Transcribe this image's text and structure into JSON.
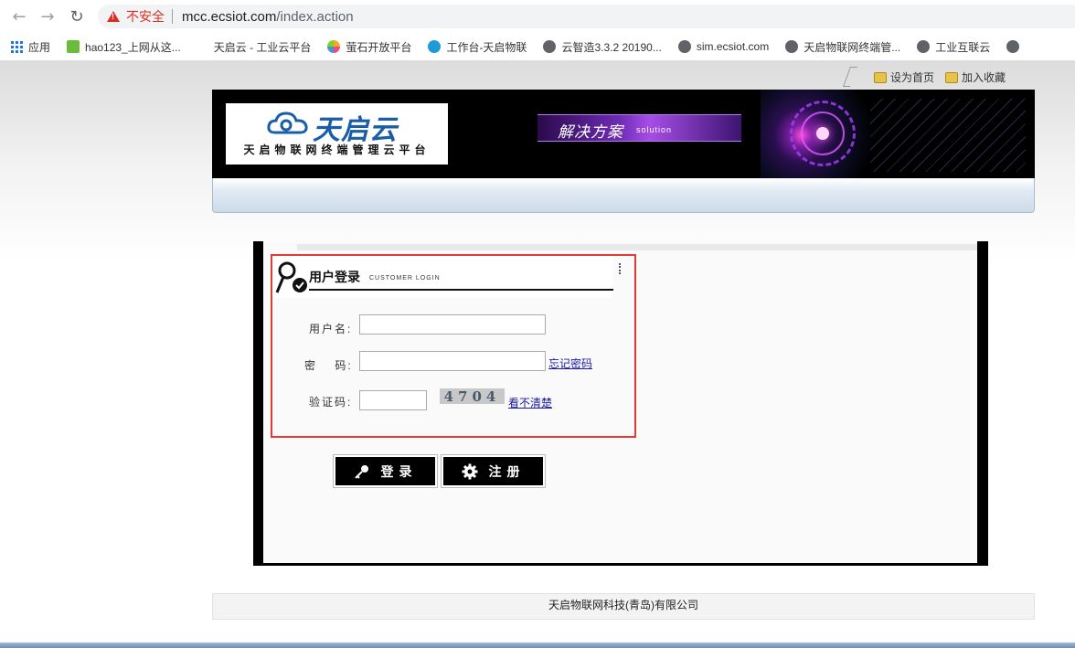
{
  "browser": {
    "security_label": "不安全",
    "url_host": "mcc.ecsiot.com",
    "url_path": "/index.action",
    "bookmarks": [
      {
        "label": "应用",
        "icon": "apps-icon"
      },
      {
        "label": "hao123_上网从这...",
        "icon": "hao123-icon"
      },
      {
        "label": "天启云 - 工业云平台",
        "icon": "blank-icon"
      },
      {
        "label": "萤石开放平台",
        "icon": "ezviz-icon"
      },
      {
        "label": "工作台-天启物联",
        "icon": "bird-icon"
      },
      {
        "label": "云智造3.3.2 20190...",
        "icon": "globe-icon"
      },
      {
        "label": "sim.ecsiot.com",
        "icon": "globe-icon"
      },
      {
        "label": "天启物联网终端管...",
        "icon": "globe-icon"
      },
      {
        "label": "工业互联云",
        "icon": "globe-icon"
      }
    ]
  },
  "toplinks": {
    "homepage": "设为首页",
    "favorite": "加入收藏"
  },
  "banner": {
    "brand": "天启云",
    "tagline": "天启物联网终端管理云平台",
    "solution_cn": "解决方案",
    "solution_en": "solution"
  },
  "login": {
    "title": "用户登录",
    "subtitle": "CUSTOMER LOGIN",
    "username_label": "用户名:",
    "username_value": "",
    "password_label": "密　 码:",
    "password_value": "",
    "forgot_link": "忘记密码",
    "captcha_label": "验证码:",
    "captcha_value": "",
    "captcha_image_text": "4704",
    "refresh_captcha_link": "看不清楚",
    "login_button": "登录",
    "register_button": "注册"
  },
  "footer": {
    "company": "天启物联网科技(青岛)有限公司"
  },
  "colors": {
    "highlight_border": "#e53935",
    "brand_blue": "#1b5ea8",
    "link": "#1a1aa6"
  }
}
